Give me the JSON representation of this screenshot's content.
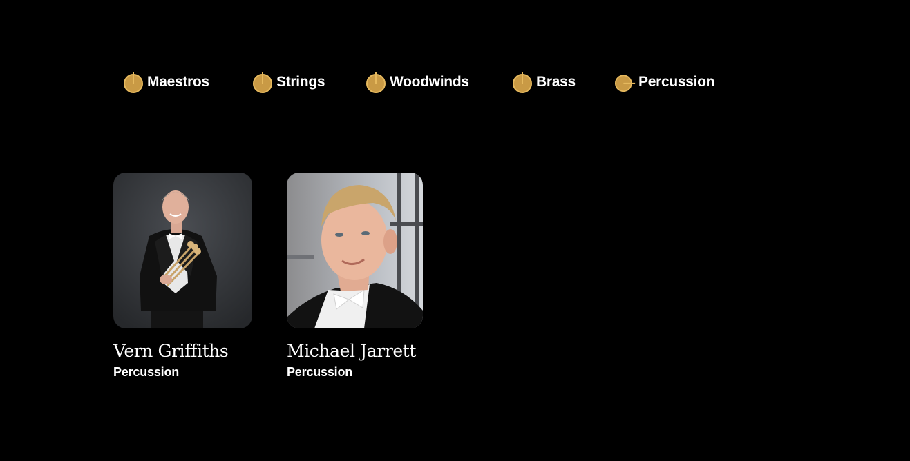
{
  "colors": {
    "background": "#000000",
    "accent": "#c99a45",
    "accent_stroke": "#e6b95e",
    "text": "#ffffff"
  },
  "filters": [
    {
      "label": "Maestros",
      "icon": "knob-icon",
      "selected": false
    },
    {
      "label": "Strings",
      "icon": "knob-icon",
      "selected": false
    },
    {
      "label": "Woodwinds",
      "icon": "knob-icon",
      "selected": false
    },
    {
      "label": "Brass",
      "icon": "knob-icon",
      "selected": false
    },
    {
      "label": "Percussion",
      "icon": "knob-icon",
      "selected": true
    }
  ],
  "members": [
    {
      "name": "Vern Griffiths",
      "section": "Percussion",
      "photo": "portrait-with-mallets"
    },
    {
      "name": "Michael Jarrett",
      "section": "Percussion",
      "photo": "portrait-headshot"
    }
  ]
}
